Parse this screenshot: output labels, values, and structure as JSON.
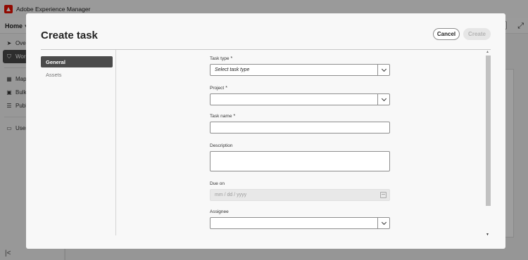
{
  "app": {
    "title": "Adobe Experience Manager",
    "home_label": "Home",
    "sidebar_items": [
      {
        "label": "Overview",
        "icon": "send-icon"
      },
      {
        "label": "Workflows",
        "icon": "shield-icon"
      },
      {
        "label": "Map",
        "icon": "map-icon"
      },
      {
        "label": "Bulk",
        "icon": "bulk-icon"
      },
      {
        "label": "Publish",
        "icon": "list-icon"
      },
      {
        "label": "User",
        "icon": "user-icon"
      }
    ]
  },
  "modal": {
    "title": "Create task",
    "cancel_label": "Cancel",
    "create_label": "Create",
    "nav": [
      {
        "label": "General",
        "selected": true
      },
      {
        "label": "Assets",
        "selected": false
      }
    ],
    "fields": {
      "task_type": {
        "label": "Task type",
        "required_mark": "*",
        "value": "Select task type"
      },
      "project": {
        "label": "Project",
        "required_mark": "*",
        "value": ""
      },
      "task_name": {
        "label": "Task name",
        "required_mark": "*",
        "value": ""
      },
      "description": {
        "label": "Description",
        "value": ""
      },
      "due_on": {
        "label": "Due on",
        "placeholder": "mm / dd / yyyy"
      },
      "assignee": {
        "label": "Assignee",
        "value": ""
      }
    }
  },
  "colors": {
    "accent": "#eb1000",
    "nav_selected": "#4b4b4b"
  }
}
